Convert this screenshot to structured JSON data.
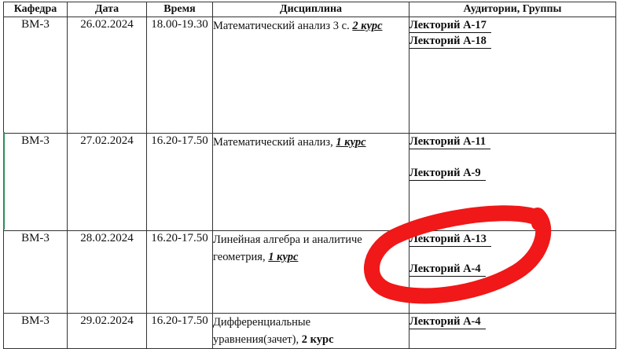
{
  "headers": {
    "dept": "Кафедра",
    "date": "Дата",
    "time": "Время",
    "subject": "Дисциплина",
    "rooms": "Аудитории, Группы"
  },
  "rows": [
    {
      "dept": "ВМ-3",
      "date": "26.02.2024",
      "time": "18.00-19.30",
      "subject": "Математический анализ 3 с.",
      "course": "2 курс",
      "rooms": [
        "Лекторий А-17",
        "Лекторий А-18"
      ]
    },
    {
      "dept": "ВМ-3",
      "date": "27.02.2024",
      "time": "16.20-17.50",
      "subject": "Математический анализ,",
      "course": "1 курс",
      "rooms": [
        "Лекторий А-11",
        "Лекторий А-9"
      ]
    },
    {
      "dept": "ВМ-3",
      "date": "28.02.2024",
      "time": "16.20-17.50",
      "subject_line1": "Линейная алгебра и аналитиче",
      "subject_line2": "геометрия,",
      "course": "1 курс",
      "rooms": [
        "Лекторий А-13",
        "Лекторий А-4"
      ]
    },
    {
      "dept": "ВМ-3",
      "date": "29.02.2024",
      "time": "16.20-17.50",
      "subject_line1": "Дифференциальные",
      "subject_line2": "уравнения(зачет),",
      "course": "2 курс",
      "rooms": [
        "Лекторий А-4"
      ]
    }
  ],
  "annotation": {
    "color": "#f01818"
  }
}
